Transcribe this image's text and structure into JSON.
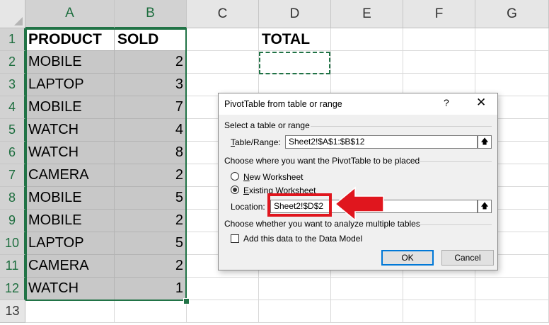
{
  "sheet": {
    "columns": [
      "A",
      "B",
      "C",
      "D",
      "E",
      "F",
      "G"
    ],
    "rows": [
      "1",
      "2",
      "3",
      "4",
      "5",
      "6",
      "7",
      "8",
      "9",
      "10",
      "11",
      "12",
      "13"
    ],
    "headers": {
      "product": "PRODUCT",
      "sold": "SOLD",
      "total": "TOTAL"
    },
    "data": [
      {
        "product": "MOBILE",
        "sold": "2"
      },
      {
        "product": "LAPTOP",
        "sold": "3"
      },
      {
        "product": "MOBILE",
        "sold": "7"
      },
      {
        "product": "WATCH",
        "sold": "4"
      },
      {
        "product": "WATCH",
        "sold": "8"
      },
      {
        "product": "CAMERA",
        "sold": "2"
      },
      {
        "product": "MOBILE",
        "sold": "5"
      },
      {
        "product": "MOBILE",
        "sold": "2"
      },
      {
        "product": "LAPTOP",
        "sold": "5"
      },
      {
        "product": "CAMERA",
        "sold": "2"
      },
      {
        "product": "WATCH",
        "sold": "1"
      }
    ]
  },
  "dialog": {
    "title": "PivotTable from table or range",
    "help": "?",
    "close": "✕",
    "section1": "Select a table or range",
    "table_range_label": "Table/Range:",
    "table_range_value": "Sheet2!$A$1:$B$12",
    "section2": "Choose where you want the PivotTable to be placed",
    "opt_new": "New Worksheet",
    "opt_existing": "Existing Worksheet",
    "location_label": "Location:",
    "location_value": "Sheet2!$D$2",
    "section3": "Choose whether you want to analyze multiple tables",
    "data_model_label": "Add this data to the Data Model",
    "ok": "OK",
    "cancel": "Cancel",
    "collapse_icon": "collapse-dialog-icon"
  },
  "colors": {
    "accent": "#217346",
    "highlight": "#e0161e"
  }
}
